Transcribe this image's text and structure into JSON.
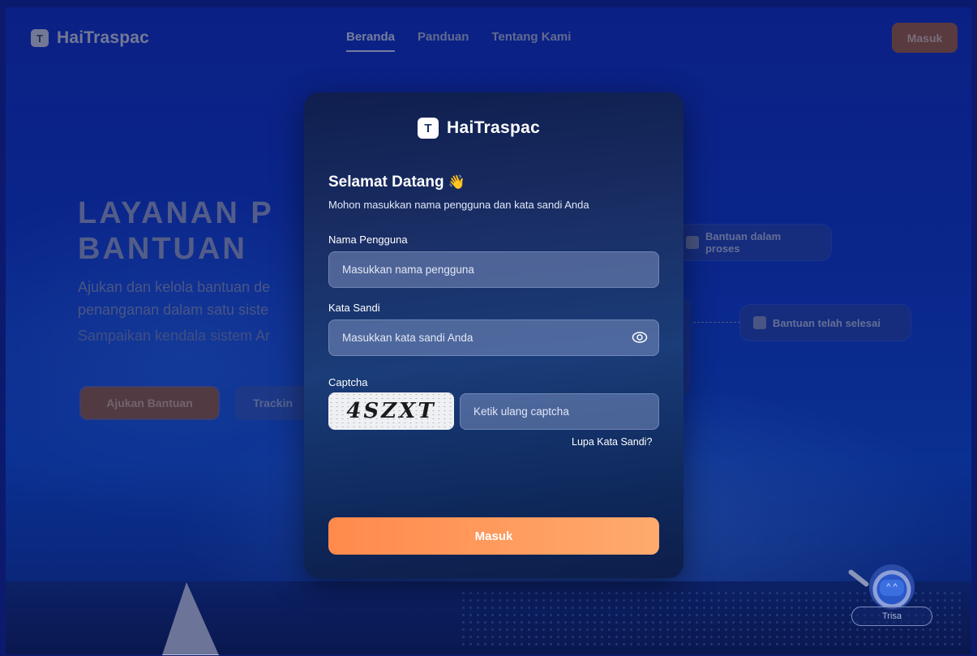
{
  "header": {
    "logo_badge": "T",
    "logo_text": "HaiTraspac",
    "nav": [
      {
        "label": "Beranda",
        "active": true
      },
      {
        "label": "Panduan",
        "active": false
      },
      {
        "label": "Tentang Kami",
        "active": false
      }
    ],
    "login_button": "Masuk"
  },
  "hero": {
    "title_line1": "LAYANAN P",
    "title_line2": "BANTUAN",
    "desc_line1": "Ajukan dan kelola bantuan de",
    "desc_line2": "penanganan dalam satu siste",
    "sub": "Sampaikan kendala sistem Ar",
    "primary_button": "Ajukan Bantuan",
    "secondary_button": "Trackin"
  },
  "status_pills": {
    "proses": "Bantuan dalam proses",
    "selesai": "Bantuan telah selesai"
  },
  "assistant": {
    "name": "Trisa",
    "face": "^ ^"
  },
  "modal": {
    "logo_badge": "T",
    "logo_text": "HaiTraspac",
    "welcome": "Selamat Datang",
    "wave": "👋",
    "description": "Mohon masukkan nama pengguna dan kata sandi Anda",
    "username_label": "Nama Pengguna",
    "username_placeholder": "Masukkan nama pengguna",
    "password_label": "Kata Sandi",
    "password_placeholder": "Masukkan kata sandi Anda",
    "captcha_label": "Captcha",
    "captcha_text": "4SZXT",
    "captcha_placeholder": "Ketik ulang captcha",
    "forgot_link": "Lupa Kata Sandi?",
    "submit_button": "Masuk"
  },
  "colors": {
    "accent": "#FF8A4C",
    "modal_bg": "#1A2F66",
    "background": "#0A36C4"
  }
}
